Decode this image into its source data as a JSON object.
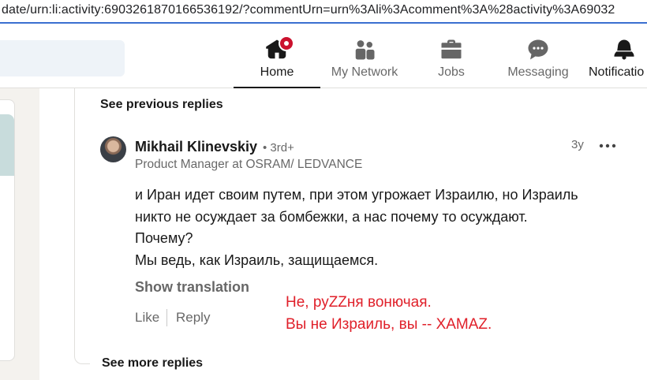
{
  "browser": {
    "url": "date/urn:li:activity:6903261870166536192/?commentUrn=urn%3Ali%3Acomment%3A%28activity%3A69032"
  },
  "nav": {
    "items": [
      {
        "label": "Home",
        "icon": "home-icon",
        "active": true
      },
      {
        "label": "My Network",
        "icon": "people-icon"
      },
      {
        "label": "Jobs",
        "icon": "briefcase-icon"
      },
      {
        "label": "Messaging",
        "icon": "chat-bubble-icon"
      },
      {
        "label": "Notificatio",
        "icon": "bell-icon"
      }
    ]
  },
  "thread": {
    "see_previous": "See previous replies",
    "see_more": "See more replies"
  },
  "comment": {
    "author": "Mikhail Klinevskiy",
    "degree": "• 3rd+",
    "headline": "Product Manager at OSRAM/ LEDVANCE",
    "time": "3y",
    "body_lines": [
      "и Иран идет своим путем, при этом угрожает Израилю, но Израиль",
      "никто не осуждает за бомбежки, а нас почему то осуждают.",
      "Почему?",
      "Мы ведь, как Израиль, защищаемся."
    ],
    "show_translation": "Show translation",
    "like": "Like",
    "reply": "Reply"
  },
  "annotation": {
    "lines": [
      "Не, руZZня вонючая.",
      "Вы не Израиль, вы -- ХАМАZ."
    ],
    "color": "#e0202a"
  },
  "colors": {
    "accent_line": "#3b6fd0",
    "badge": "#cb112d"
  }
}
